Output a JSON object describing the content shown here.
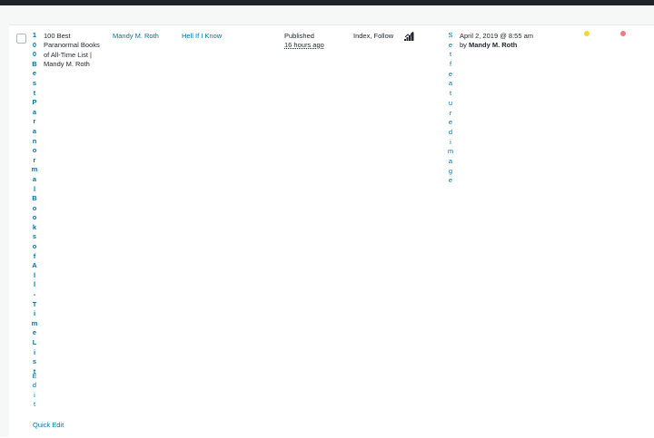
{
  "colors": {
    "link": "#0073aa",
    "text": "#23282d",
    "seo_score": "#f5d33b",
    "readability_score": "#ec7a80"
  },
  "row": {
    "title_vertical": [
      "1",
      "0",
      "0",
      "B",
      "e",
      "s",
      "t",
      "P",
      "a",
      "r",
      "a",
      "n",
      "o",
      "r",
      "m",
      "a",
      "l",
      "B",
      "o",
      "o",
      "k",
      "s",
      "o",
      "f",
      "A",
      "l",
      "l",
      "-",
      "T",
      "i",
      "m",
      "e",
      "L",
      "i",
      "s",
      "t"
    ],
    "title_lines": [
      "100 Best",
      "Paranormal Books",
      "of All-Time List |",
      "Mandy M. Roth"
    ],
    "edit_vertical": [
      "E",
      "d",
      "i",
      "t"
    ],
    "quick_edit": "Quick Edit",
    "author": "Mandy M. Roth",
    "category": "Hell If I Know",
    "status": "Published",
    "status_ago": "16 hours ago",
    "robots": "Index, Follow",
    "seo_icon": "bar-chart-icon",
    "featured_image_vertical": [
      "S",
      "e",
      "t",
      "f",
      "e",
      "a",
      "t",
      "u",
      "r",
      "e",
      "d",
      "i",
      "m",
      "a",
      "g",
      "e"
    ],
    "date": "April 2, 2019 @ 8:55 am",
    "date_by": "by",
    "date_author": "Mandy M. Roth",
    "seo_score_icon": "seo-score-dot-icon",
    "readability_icon": "readability-score-dot-icon"
  }
}
